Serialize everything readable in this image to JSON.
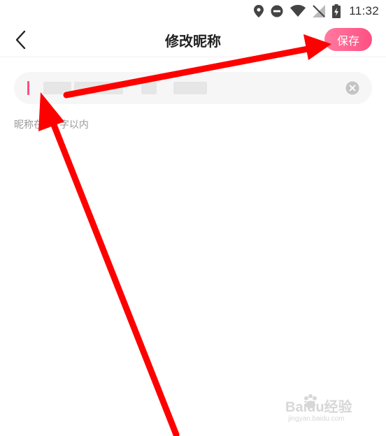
{
  "status_bar": {
    "time": "11:32",
    "icons": [
      "location-icon",
      "dnd-icon",
      "wifi-icon",
      "no-signal-icon",
      "battery-charging-icon"
    ]
  },
  "nav": {
    "back_icon": "chevron-left-icon",
    "title": "修改昵称",
    "save_label": "保存"
  },
  "nickname_input": {
    "value": "",
    "clear_icon": "clear-circle-icon"
  },
  "hint": "昵称在1个字以内",
  "annotation": {
    "color": "#ff0000",
    "arrows": [
      "arrow-to-input",
      "arrow-to-save-button"
    ]
  },
  "watermark": {
    "brand": "Baidu经验",
    "url": "jingyan.baidu.com"
  },
  "colors": {
    "accent": "#ff4f82",
    "input_bg": "#f6f6f6",
    "hint_text": "#999999"
  }
}
